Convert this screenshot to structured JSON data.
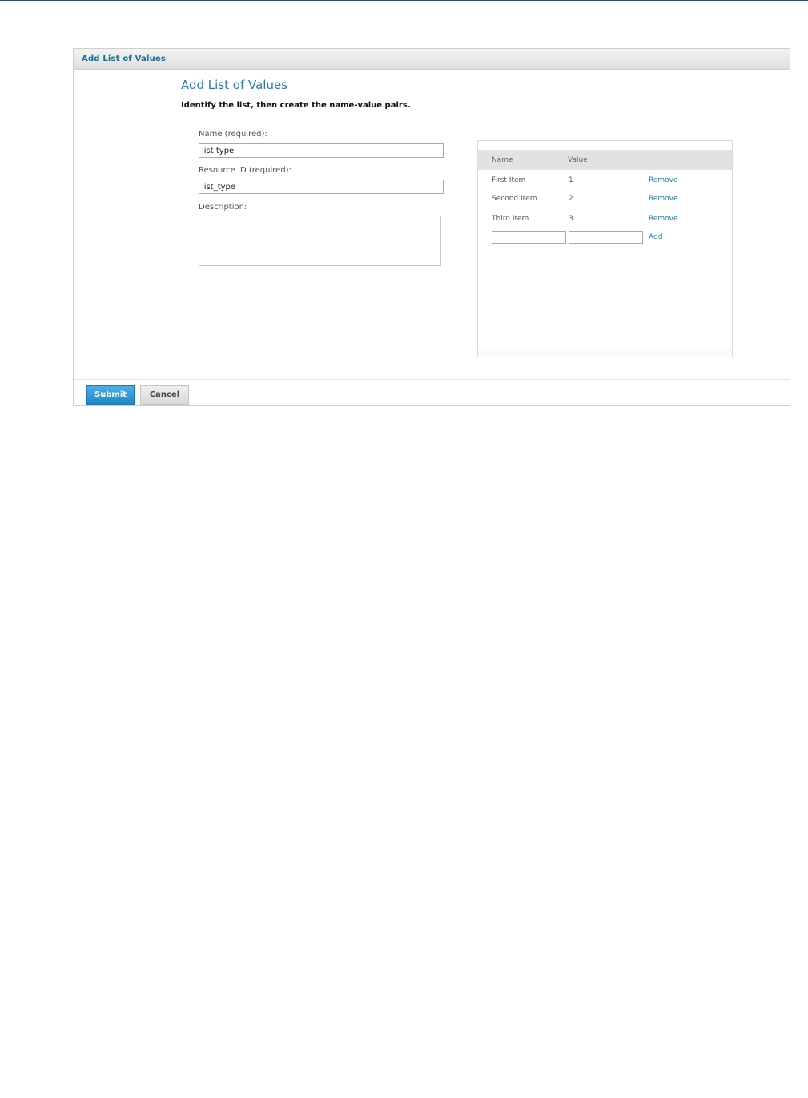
{
  "panel": {
    "header_title": "Add List of Values",
    "page_title": "Add List of Values",
    "instructions": "Identify the list, then create the name-value pairs."
  },
  "form": {
    "name_label": "Name (required):",
    "name_value": "list type",
    "resource_id_label": "Resource ID (required):",
    "resource_id_value": "list_type",
    "description_label": "Description:",
    "description_value": ""
  },
  "values_table": {
    "headers": {
      "name": "Name",
      "value": "Value"
    },
    "rows": [
      {
        "name": "First Item",
        "value": "1",
        "action": "Remove"
      },
      {
        "name": "Second Item",
        "value": "2",
        "action": "Remove"
      },
      {
        "name": "Third Item",
        "value": "3",
        "action": "Remove"
      }
    ],
    "new_name_value": "",
    "new_value_value": "",
    "add_label": "Add"
  },
  "buttons": {
    "submit": "Submit",
    "cancel": "Cancel"
  },
  "colors": {
    "accent": "#2a7bb0",
    "submit_bg": "#1e86c8",
    "rule": "#1f4e79"
  }
}
